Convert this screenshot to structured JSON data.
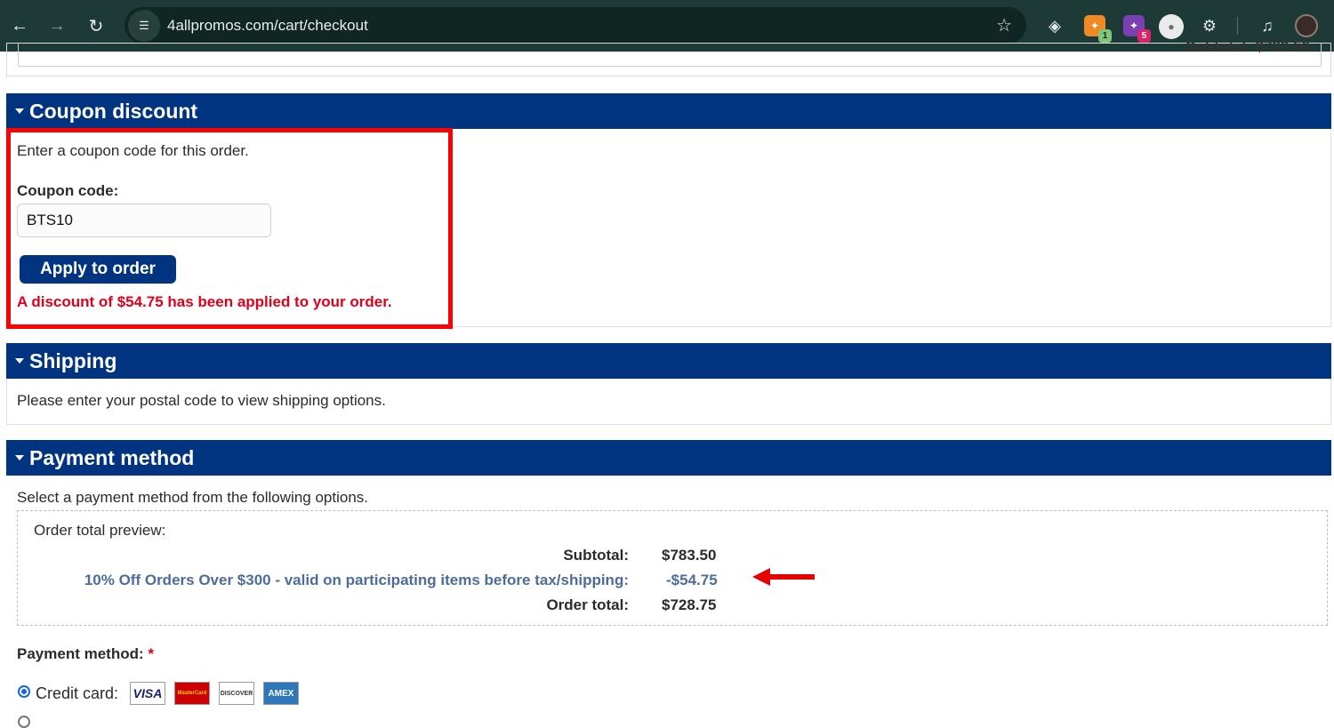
{
  "browser": {
    "url": "4allpromos.com/cart/checkout",
    "extensions": [
      {
        "name": "tampermonkey-icon",
        "badge": ""
      },
      {
        "name": "extension-orange-icon",
        "badge": "1"
      },
      {
        "name": "extension-purple-icon",
        "badge": "5"
      },
      {
        "name": "extension-circle-icon",
        "badge": ""
      }
    ]
  },
  "top_section": {
    "subtotal_cut": "Subtotal: $783.50"
  },
  "coupon": {
    "header": "Coupon discount",
    "intro": "Enter a coupon code for this order.",
    "label": "Coupon code:",
    "value": "BTS10",
    "button": "Apply to order",
    "message": "A discount of $54.75 has been applied to your order."
  },
  "shipping": {
    "header": "Shipping",
    "text": "Please enter your postal code to view shipping options."
  },
  "payment": {
    "header": "Payment method",
    "intro": "Select a payment method from the following options.",
    "preview_title": "Order total preview:",
    "rows": [
      {
        "label": "Subtotal:",
        "value": "$783.50"
      },
      {
        "label": "10% Off Orders Over $300 - valid on participating items before tax/shipping:",
        "value": "-$54.75"
      },
      {
        "label": "Order total:",
        "value": "$728.75"
      }
    ],
    "method_label": "Payment method:",
    "required_mark": "*",
    "credit_card_label": "Credit card:",
    "cards": [
      "VISA",
      "MasterCard",
      "DISCOVER",
      "AMEX"
    ]
  },
  "colors": {
    "header_blue": "#003380",
    "highlight_red": "#ff0000",
    "discount_text": "#4d6c9c"
  }
}
